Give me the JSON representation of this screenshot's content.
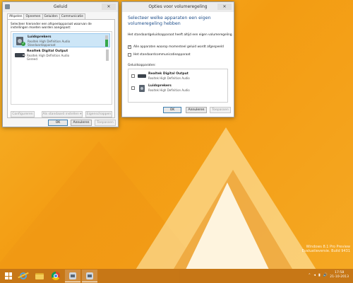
{
  "colors": {
    "desktop": "#f5a623",
    "accent_title": "#1f4f8b",
    "selection": "#cde6f7",
    "meter_on": "#36a84b"
  },
  "geluid": {
    "title": "Geluid",
    "close_label": "✕",
    "tabs": [
      "Afspelen",
      "Opnemen",
      "Geluiden",
      "Communicatie"
    ],
    "active_tab": "Afspelen",
    "instruction": "Selecteer hieronder een afspeelapparaat waarvan de instellingen moeten worden aangepast:",
    "devices": [
      {
        "name": "Luidsprekers",
        "driver": "Realtek High Definition Audio",
        "status": "Standaardapparaat",
        "icon": "speaker-icon",
        "selected": true
      },
      {
        "name": "Realtek Digital Output",
        "driver": "Realtek High Definition Audio",
        "status": "Gereed",
        "icon": "digital-output-icon",
        "selected": false
      }
    ],
    "buttons": {
      "configure": "Configureren",
      "set_default": "Als standaard instellen",
      "set_default_arrow": "▾",
      "properties": "Eigenschappen",
      "ok": "OK",
      "cancel": "Annuleren",
      "apply": "Toepassen"
    }
  },
  "opties": {
    "title": "Opties voor volumeregeling",
    "close_label": "✕",
    "heading": "Selecteer welke apparaten een eigen volumeregeling hebben",
    "info": "Het standaardgeluidsapparaat heeft altijd een eigen volumeregeling.",
    "checkbox_all": {
      "label": "Alle apparaten waarop momenteel geluid wordt afgespeeld",
      "checked": true,
      "mark": "✓"
    },
    "checkbox_comm": {
      "label": "Het standaardcommunicatieapparaat",
      "checked": false,
      "mark": ""
    },
    "list_label": "Geluidsapparaten:",
    "devices": [
      {
        "name": "Realtek Digital Output",
        "driver": "Realtek High Definition Audio",
        "checked": false,
        "icon": "digital-output-icon"
      },
      {
        "name": "Luidsprekers",
        "driver": "Realtek High Definition Audio",
        "checked": false,
        "icon": "speaker-icon"
      }
    ],
    "buttons": {
      "ok": "OK",
      "cancel": "Annuleren",
      "apply": "Toepassen"
    }
  },
  "desktop": {
    "watermark_line1": "Windows 8.1 Pro Preview",
    "watermark_line2": "Evaluatieversie. Build 9431"
  },
  "taskbar": {
    "items": [
      "start-icon",
      "internet-explorer-icon",
      "file-explorer-icon",
      "chrome-icon",
      "volume-icon",
      "volume-icon"
    ],
    "tray_icons": [
      "⌃",
      "◂",
      "▮",
      "🔊"
    ],
    "time": "17:58",
    "date": "21-10-2013"
  }
}
